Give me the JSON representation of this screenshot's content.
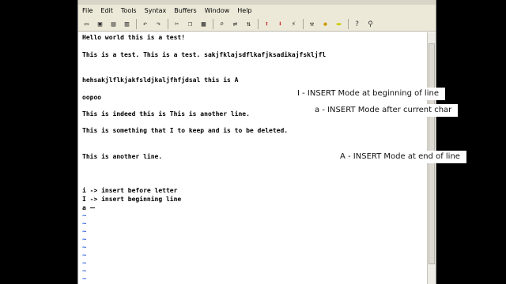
{
  "menu": [
    "File",
    "Edit",
    "Tools",
    "Syntax",
    "Buffers",
    "Window",
    "Help"
  ],
  "toolbar": [
    "open-icon",
    "save-icon",
    "save-all-icon",
    "print-icon",
    "undo-icon",
    "redo-icon",
    "cut-icon",
    "copy-icon",
    "paste-icon",
    "find-icon",
    "replace-icon",
    "find-prev-icon",
    "load-session-icon",
    "save-session-icon",
    "run-script-icon",
    "make-icon",
    "shell-icon",
    "tags-icon",
    "help-icon",
    "find-help-icon"
  ],
  "lines": [
    "Hello world this is a test!",
    "This is a test. This is a test. sakjfklajsdflkafjksadikajfskljfl",
    "hehsakjlflkjakfsldjkaljfhfjdsal this is A",
    "oopoo",
    "This is indeed this is This is another line.",
    "This is something that I to keep and is to be deleted.",
    "This is another line.",
    "i -> insert before letter",
    "I -> insert beginning line",
    "a "
  ],
  "tilde": "~",
  "callouts": [
    "I - INSERT Mode at beginning of line",
    "a - INSERT Mode after current char",
    "A - INSERT Mode at end of line"
  ],
  "colors": {
    "tilde": "#2c5ed8",
    "chrome": "#ece9d8"
  }
}
